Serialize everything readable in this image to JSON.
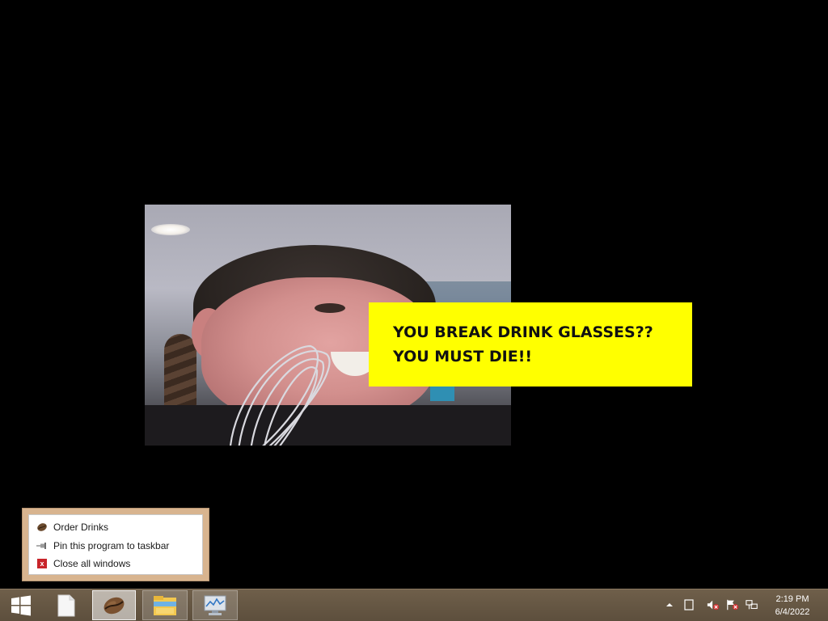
{
  "banner": {
    "line1": "YOU BREAK DRINK GLASSES??",
    "line2": "YOU MUST DIE!!",
    "background_color": "#ffff00"
  },
  "jump_list": {
    "items": [
      {
        "label": "Order Drinks",
        "icon": "coffee-bean-icon"
      },
      {
        "label": "Pin this program to taskbar",
        "icon": "pin-icon"
      },
      {
        "label": "Close all windows",
        "icon": "close-icon"
      }
    ]
  },
  "taskbar": {
    "buttons": [
      {
        "name": "start",
        "icon": "windows-logo-icon"
      },
      {
        "name": "file",
        "icon": "blank-file-icon"
      },
      {
        "name": "order-drinks",
        "icon": "coffee-bean-icon",
        "active": true
      },
      {
        "name": "file-explorer",
        "icon": "folder-icon"
      },
      {
        "name": "performance-monitor",
        "icon": "monitor-icon"
      }
    ],
    "tray": {
      "icons": [
        "show-hidden-icons-arrow",
        "action-center-icon",
        "volume-muted-icon",
        "flag-icon",
        "network-icon"
      ]
    },
    "clock": {
      "time": "2:19 PM",
      "date": "6/4/2022"
    },
    "color": "#6f5f4a"
  }
}
